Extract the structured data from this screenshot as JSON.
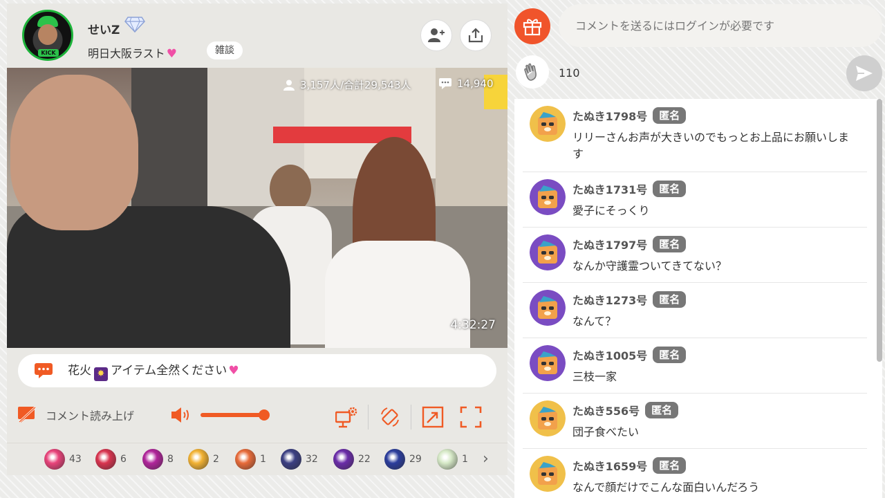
{
  "streamer": {
    "name": "せいZ",
    "badge_icon": "diamond-icon",
    "avatar_text": "KICK",
    "title": "明日大阪ラスト",
    "category": "雑談"
  },
  "header_buttons": {
    "follow_icon": "add-user-icon",
    "share_icon": "share-icon"
  },
  "video": {
    "viewers": "3,157人/合計29,543人",
    "comments": "14,940",
    "elapsed": "4:32:27"
  },
  "telop": {
    "text_before": "花火",
    "text_after": "アイテム全然ください"
  },
  "controls": {
    "read_aloud_label": "コメント読み上げ",
    "volume_percent": 100
  },
  "items": [
    {
      "icon": "heart-bouquet-icon",
      "count": "43",
      "color": "#e8437a"
    },
    {
      "icon": "mushroom-icon",
      "count": "6",
      "color": "#d8344f"
    },
    {
      "icon": "hearts-firework-icon",
      "count": "8",
      "color": "#b0259a"
    },
    {
      "icon": "rainbow-firework-icon",
      "count": "2",
      "color": "#f2b233"
    },
    {
      "icon": "sunset-firework-icon",
      "count": "1",
      "color": "#e76b3a"
    },
    {
      "icon": "city-firework-icon",
      "count": "32",
      "color": "#3b3f82"
    },
    {
      "icon": "purple-firework-icon",
      "count": "22",
      "color": "#6a2ca8"
    },
    {
      "icon": "blue-firework-icon",
      "count": "29",
      "color": "#2b3d9c"
    },
    {
      "icon": "clover-icon",
      "count": "1",
      "color": "#d6e9c7"
    }
  ],
  "chat": {
    "input_placeholder": "コメントを送るにはログインが必要です",
    "clap_count": "110",
    "comments": [
      {
        "name": "たぬき1798号",
        "badge": "匿名",
        "text": "リリーさんお声が大きいのでもっとお上品にお願いします",
        "avatar_color": "#f0c04a"
      },
      {
        "name": "たぬき1731号",
        "badge": "匿名",
        "text": "愛子にそっくり",
        "avatar_color": "#7a4cc2"
      },
      {
        "name": "たぬき1797号",
        "badge": "匿名",
        "text": "なんか守護霊ついてきてない？",
        "avatar_color": "#7a4cc2"
      },
      {
        "name": "たぬき1273号",
        "badge": "匿名",
        "text": "なんて？",
        "avatar_color": "#7a4cc2"
      },
      {
        "name": "たぬき1005号",
        "badge": "匿名",
        "text": "三枝一家",
        "avatar_color": "#7a4cc2"
      },
      {
        "name": "たぬき556号",
        "badge": "匿名",
        "text": "団子食べたい",
        "avatar_color": "#f0c04a"
      },
      {
        "name": "たぬき1659号",
        "badge": "匿名",
        "text": "なんで顔だけでこんな面白いんだろう",
        "avatar_color": "#f0c04a"
      }
    ]
  },
  "colors": {
    "accent": "#f05a24",
    "background": "#ececea",
    "anon_badge": "#777777"
  }
}
